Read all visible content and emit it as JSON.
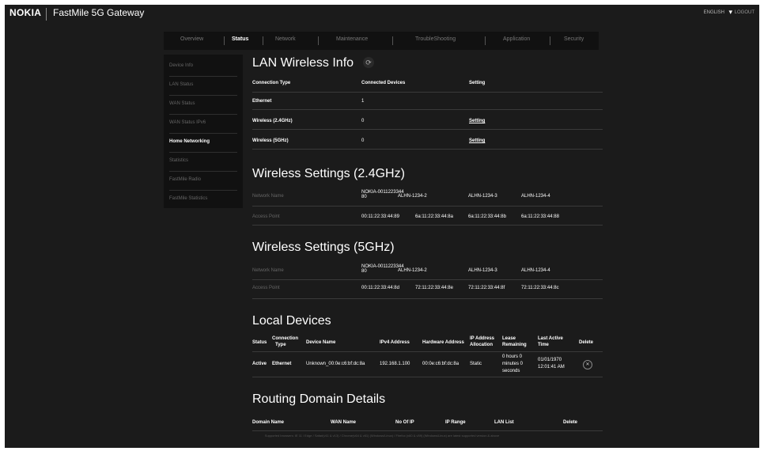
{
  "header": {
    "brand": "NOKIA",
    "product": "FastMile 5G Gateway",
    "language": "ENGLISH",
    "logout": "LOGOUT"
  },
  "tabs": [
    "Overview",
    "Status",
    "Network",
    "Maintenance",
    "TroubleShooting",
    "Application",
    "Security"
  ],
  "sidebar": [
    "Device Info",
    "LAN Status",
    "WAN Status",
    "WAN Status IPv6",
    "Home Networking",
    "Statistics",
    "FastMile Radio",
    "FastMile Statistics"
  ],
  "lan": {
    "title": "LAN Wireless Info",
    "headers": [
      "Connection Type",
      "Connected Devices",
      "Setting"
    ],
    "rows": [
      {
        "type": "Ethernet",
        "count": "1",
        "setting": ""
      },
      {
        "type": "Wireless (2.4GHz)",
        "count": "0",
        "setting": "Setting"
      },
      {
        "type": "Wireless (5GHz)",
        "count": "0",
        "setting": "Setting"
      }
    ]
  },
  "w24": {
    "title": "Wireless Settings (2.4GHz)",
    "name_label": "Network Name",
    "names": [
      "NOKIA-0011223344",
      "80",
      "ALHN-1234-2",
      "ALHN-1234-3",
      "ALHN-1234-4"
    ],
    "ap_label": "Access Point",
    "aps": [
      "00:11:22:33:44:89",
      "6a:11:22:33:44:8a",
      "6a:11:22:33:44:8b",
      "6a:11:22:33:44:88"
    ]
  },
  "w5": {
    "title": "Wireless Settings (5GHz)",
    "name_label": "Network Name",
    "names": [
      "NOKIA-0011223344",
      "80",
      "ALHN-1234-2",
      "ALHN-1234-3",
      "ALHN-1234-4"
    ],
    "ap_label": "Access Point",
    "aps": [
      "00:11:22:33:44:8d",
      "72:11:22:33:44:8e",
      "72:11:22:33:44:8f",
      "72:11:22:33:44:8c"
    ]
  },
  "local": {
    "title": "Local Devices",
    "headers": [
      "Status",
      "Connection",
      "Type",
      "Device Name",
      "IPv4 Address",
      "Hardware Address",
      "IP Address",
      "Allocation",
      "Lease",
      "Remaining",
      "Last Active",
      "Time",
      "Delete"
    ],
    "row": {
      "status": "Active",
      "conn": "Ethernet",
      "name": "Unknown_00:0e:c6:bf:dc:8a",
      "ip": "192.168.1.100",
      "mac": "00:0e:c6:bf:dc:8a",
      "alloc": "Static",
      "lease": [
        "0 hours 0",
        "minutes 0",
        "seconds"
      ],
      "last": [
        "01/01/1970",
        "12:01:41 AM"
      ]
    }
  },
  "routing": {
    "title": "Routing Domain Details",
    "headers": [
      "Domain Name",
      "WAN Name",
      "No Of IP",
      "IP Range",
      "LAN List",
      "Delete"
    ]
  },
  "footer": "Supported browsers: IE 11 / Edge / Safari(v11 & v13) / Chrome(v64 & v61) (Windows/Linux) / Firefox (v60 & v59) (Windows/Linux) are latest supported version & above",
  "colors": {
    "background": "#1b1b1b",
    "panel": "#111111",
    "text": "#ffffff",
    "muted": "#666666"
  }
}
